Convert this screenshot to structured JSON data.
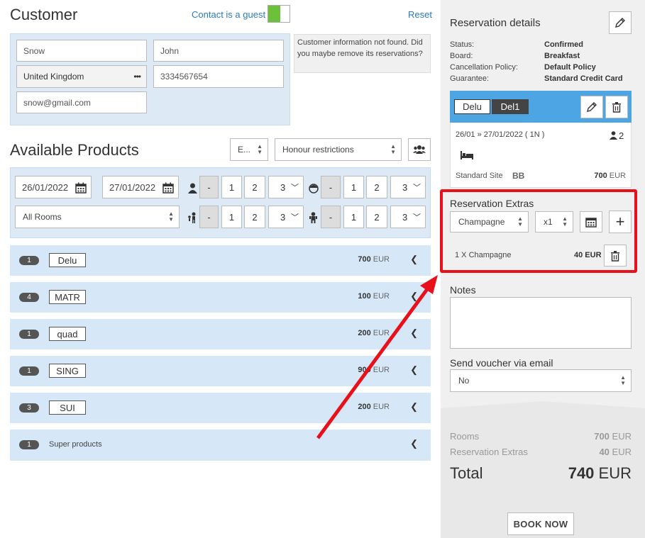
{
  "customer": {
    "title": "Customer",
    "guest_label": "Contact is a guest",
    "reset": "Reset",
    "lastname": "Snow",
    "firstname": "John",
    "country": "United Kingdom",
    "phone": "3334567654",
    "email": "snow@gmail.com",
    "notice": "Customer information not found. Did you maybe remove its reservations?"
  },
  "products": {
    "title": "Available Products",
    "lang_select": "E...",
    "restrictions_select": "Honour restrictions",
    "date_from": "26/01/2022",
    "date_to": "27/01/2022",
    "rooms_select": "All Rooms",
    "counters": {
      "minus": "-",
      "one": "1",
      "two": "2",
      "three": "3"
    },
    "rows": [
      {
        "count": "1",
        "code": "Delu",
        "price": "700",
        "currency": "EUR"
      },
      {
        "count": "4",
        "code": "MATR",
        "price": "100",
        "currency": "EUR"
      },
      {
        "count": "1",
        "code": "quad",
        "price": "200",
        "currency": "EUR"
      },
      {
        "count": "1",
        "code": "SING",
        "price": "900",
        "currency": "EUR"
      },
      {
        "count": "3",
        "code": "SUI",
        "price": "200",
        "currency": "EUR"
      }
    ],
    "super_row": {
      "count": "1",
      "label": "Super products"
    }
  },
  "reservation": {
    "title": "Reservation details",
    "status_label": "Status:",
    "status_value": "Confirmed",
    "board_label": "Board:",
    "board_value": "Breakfast",
    "policy_label": "Cancellation Policy:",
    "policy_value": "Default Policy",
    "guarantee_label": "Guarantee:",
    "guarantee_value": "Standard Credit Card",
    "card": {
      "tab1": "Delu",
      "tab2": "Del1",
      "dates": "26/01 » 27/01/2022 ( 1N )",
      "guests": "2",
      "site": "Standard Site",
      "board_code": "BB",
      "price": "700",
      "currency": "EUR"
    }
  },
  "extras": {
    "title": "Reservation Extras",
    "item_select": "Champagne",
    "qty_select": "x1",
    "line_label": "1 X Champagne",
    "line_price": "40 EUR"
  },
  "notes": {
    "title": "Notes",
    "value": ""
  },
  "voucher": {
    "title": "Send voucher via email",
    "value": "No"
  },
  "summary": {
    "rooms_label": "Rooms",
    "rooms_price": "700",
    "extras_label": "Reservation Extras",
    "extras_price": "40",
    "currency": "EUR",
    "total_label": "Total",
    "total_value": "740",
    "total_currency": "EUR"
  },
  "book_button": "BOOK NOW",
  "colors": {
    "highlight": "#e8101a",
    "header_blue": "#4da6e3",
    "row_blue": "#d6e8f7",
    "toggle_green": "#6cc03a"
  }
}
